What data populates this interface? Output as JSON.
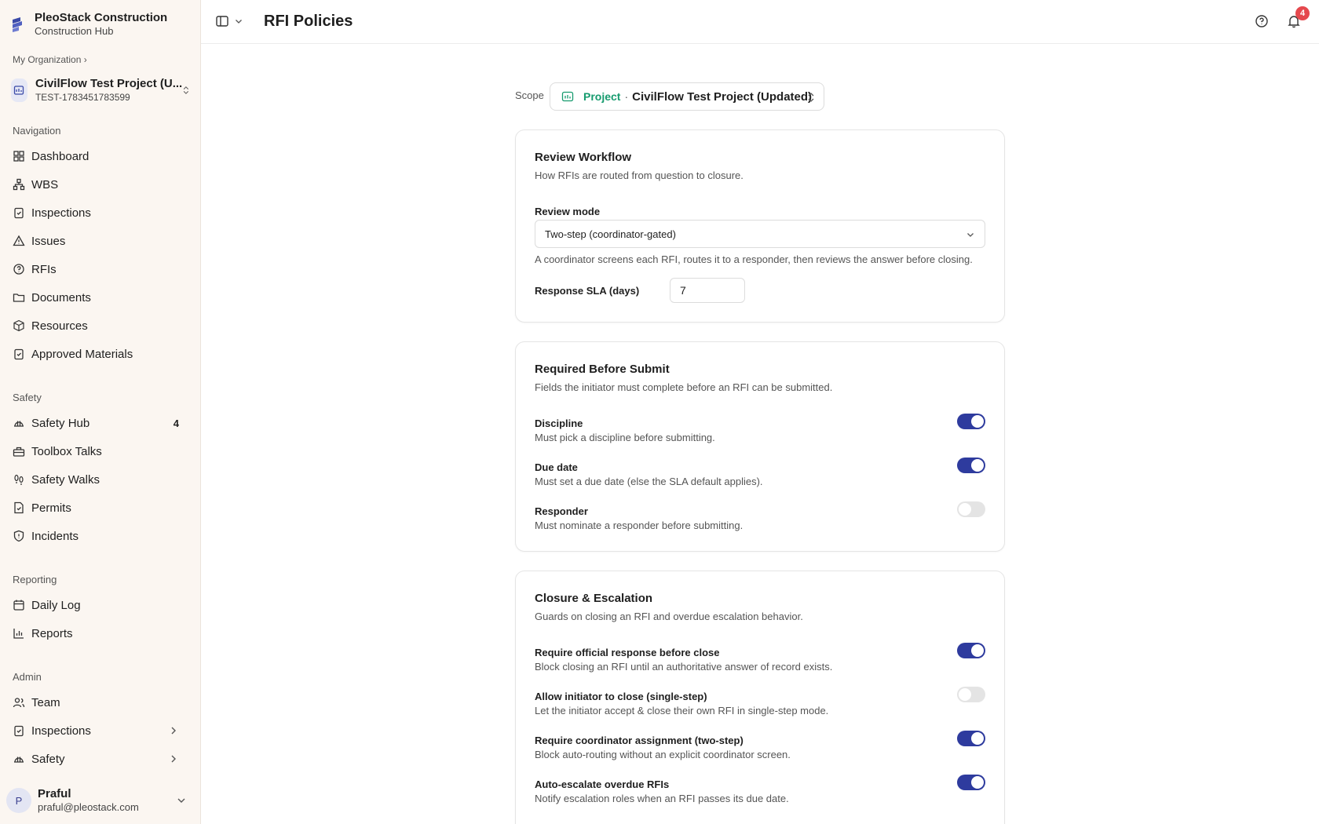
{
  "brand": {
    "name": "PleoStack Construction",
    "sub": "Construction Hub"
  },
  "breadcrumb": "My Organization ›",
  "project": {
    "name": "CivilFlow Test Project (U...",
    "id": "TEST-1783451783599"
  },
  "nav": {
    "section_navigation": "Navigation",
    "items": [
      "Dashboard",
      "WBS",
      "Inspections",
      "Issues",
      "RFIs",
      "Documents",
      "Resources",
      "Approved Materials"
    ],
    "section_safety": "Safety",
    "safety_items": [
      "Safety Hub",
      "Toolbox Talks",
      "Safety Walks",
      "Permits",
      "Incidents"
    ],
    "safety_hub_badge": "4",
    "section_reporting": "Reporting",
    "reporting_items": [
      "Daily Log",
      "Reports"
    ],
    "section_admin": "Admin",
    "admin_items": [
      "Team",
      "Inspections",
      "Safety"
    ]
  },
  "user": {
    "initial": "P",
    "name": "Praful",
    "email": "praful@pleostack.com"
  },
  "header": {
    "title": "RFI Policies",
    "notification_count": "4"
  },
  "scope": {
    "label": "Scope",
    "type": "Project",
    "separator": "·",
    "name": "CivilFlow Test Project (Updated)"
  },
  "review_workflow": {
    "title": "Review Workflow",
    "subtitle": "How RFIs are routed from question to closure.",
    "review_mode_label": "Review mode",
    "review_mode_value": "Two-step (coordinator-gated)",
    "review_mode_help": "A coordinator screens each RFI, routes it to a responder, then reviews the answer before closing.",
    "sla_label": "Response SLA (days)",
    "sla_value": "7"
  },
  "required_before_submit": {
    "title": "Required Before Submit",
    "subtitle": "Fields the initiator must complete before an RFI can be submitted.",
    "options": [
      {
        "title": "Discipline",
        "desc": "Must pick a discipline before submitting.",
        "enabled": true
      },
      {
        "title": "Due date",
        "desc": "Must set a due date (else the SLA default applies).",
        "enabled": true
      },
      {
        "title": "Responder",
        "desc": "Must nominate a responder before submitting.",
        "enabled": false
      }
    ]
  },
  "closure_escalation": {
    "title": "Closure & Escalation",
    "subtitle": "Guards on closing an RFI and overdue escalation behavior.",
    "options": [
      {
        "title": "Require official response before close",
        "desc": "Block closing an RFI until an authoritative answer of record exists.",
        "enabled": true
      },
      {
        "title": "Allow initiator to close (single-step)",
        "desc": "Let the initiator accept & close their own RFI in single-step mode.",
        "enabled": false
      },
      {
        "title": "Require coordinator assignment (two-step)",
        "desc": "Block auto-routing without an explicit coordinator screen.",
        "enabled": true
      },
      {
        "title": "Auto-escalate overdue RFIs",
        "desc": "Notify escalation roles when an RFI passes its due date.",
        "enabled": true
      }
    ]
  },
  "colors": {
    "accent": "#2e3b9e",
    "scope_type": "#169b6e",
    "badge": "#e5484d",
    "sidebar_bg": "#fbf6f1"
  }
}
